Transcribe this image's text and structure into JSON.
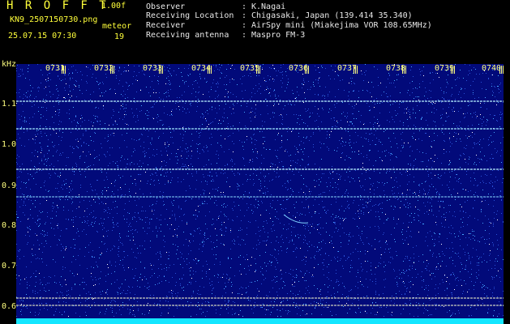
{
  "header": {
    "app_title": "H R O F F T",
    "version": "1.00f",
    "filename": "KN9_2507150730.png",
    "meteor_label": "meteor",
    "datetime": "25.07.15 07:30",
    "meteor_count": "19"
  },
  "meta": [
    {
      "key": "Observer",
      "value": "K.Nagai"
    },
    {
      "key": "Receiving Location",
      "value": "Chigasaki, Japan (139.414 35.340)"
    },
    {
      "key": "Receiver",
      "value": "AirSpy mini (Miakejima VOR 108.65MHz)"
    },
    {
      "key": "Receiving antenna",
      "value": "Maspro FM-3"
    }
  ],
  "axis": {
    "unit": "kHz",
    "y_ticks": [
      "1.1",
      "1.0",
      "0.9",
      "0.8",
      "0.7",
      "0.6"
    ],
    "time_ticks": [
      "0731",
      "0732",
      "0733",
      "0734",
      "0735",
      "0736",
      "0737",
      "0738",
      "0739",
      "0740"
    ]
  },
  "colors": {
    "background": "#000000",
    "header_text": "#ffff3a",
    "meta_text": "#e8e8e8",
    "plot_noise_base": "#020a7a",
    "baseline": "#14e6ff"
  }
}
